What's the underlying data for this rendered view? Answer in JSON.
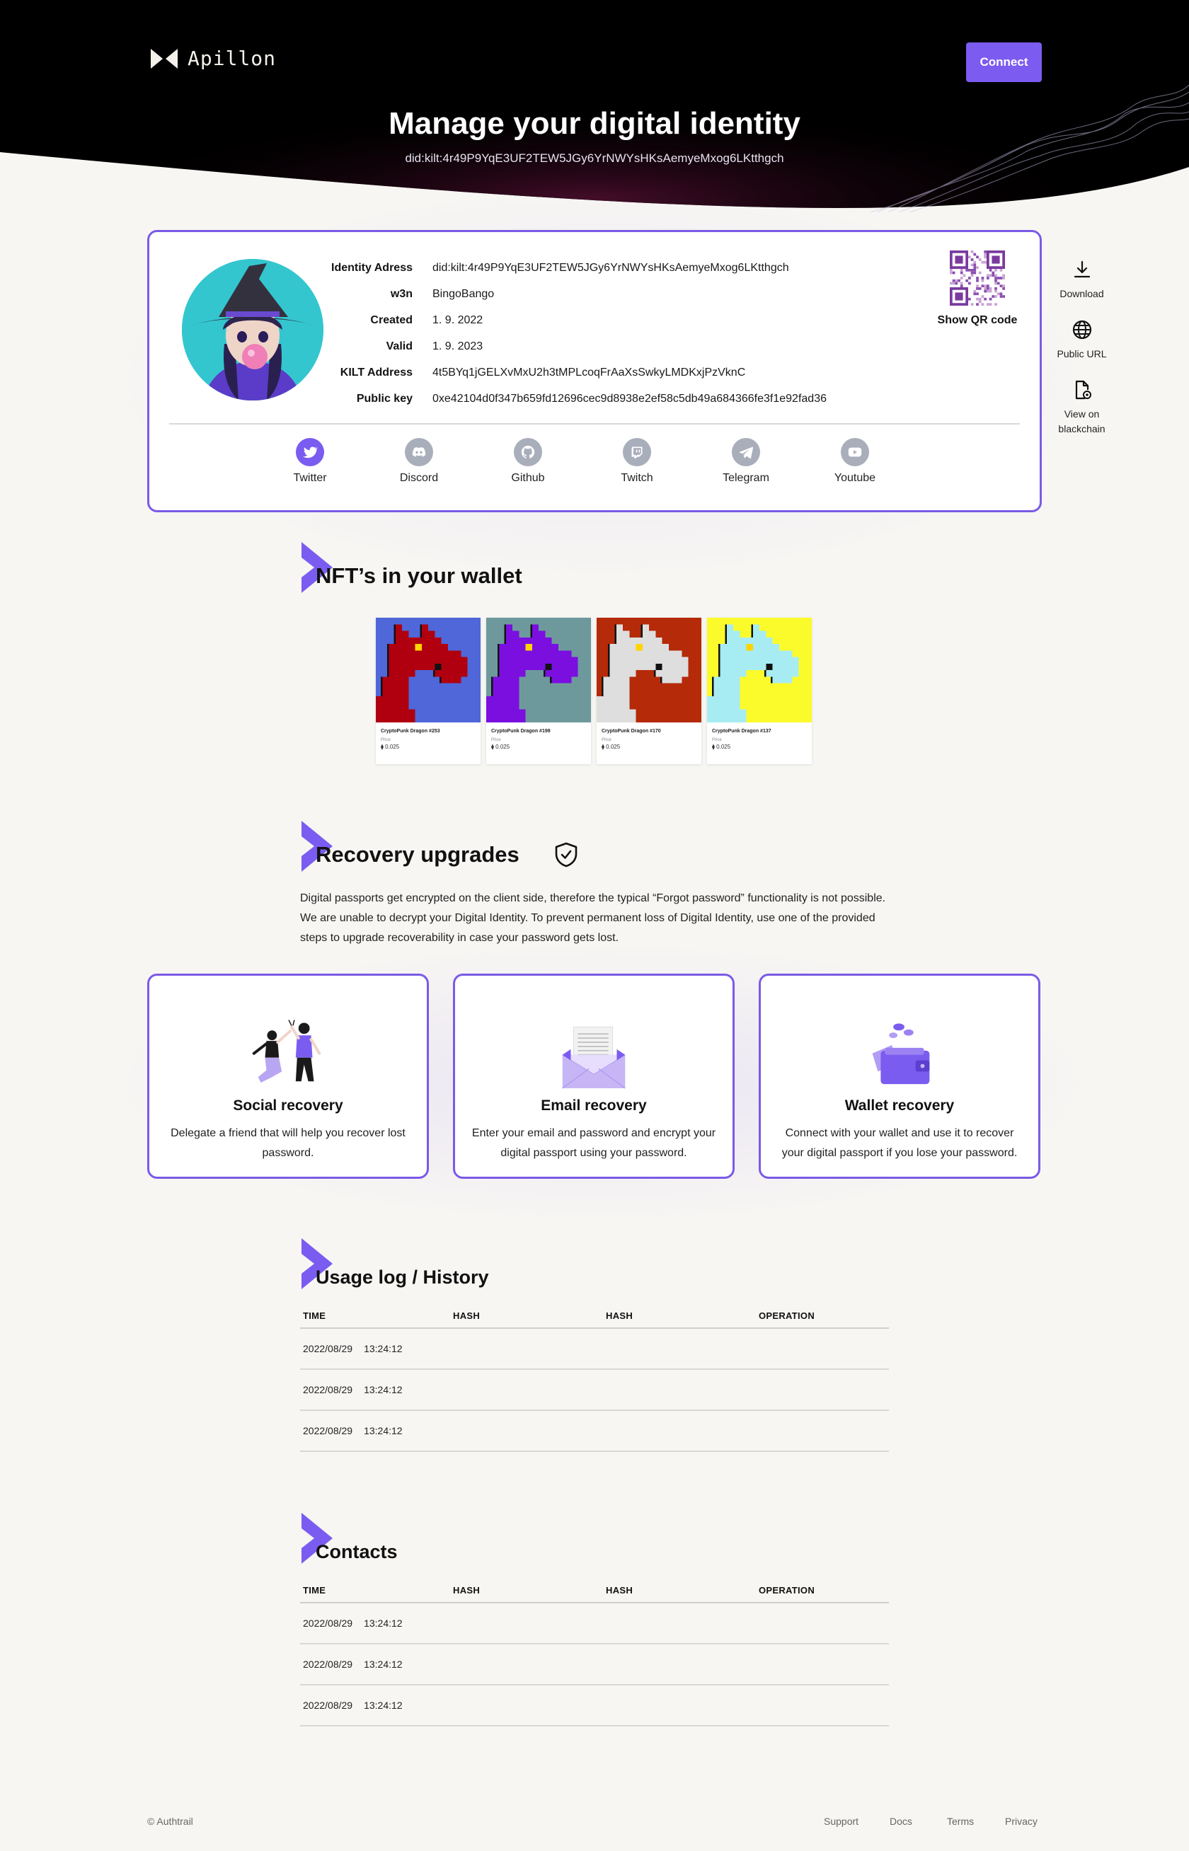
{
  "header": {
    "brand": "Apillon",
    "connect_label": "Connect",
    "title": "Manage your digital identity",
    "did": "did:kilt:4r49P9YqE3UF2TEW5JGy6YrNWYsHKsAemyeMxog6LKtthgch"
  },
  "identity": {
    "rows": [
      {
        "label": "Identity Adress",
        "value": "did:kilt:4r49P9YqE3UF2TEW5JGy6YrNWYsHKsAemyeMxog6LKtthgch"
      },
      {
        "label": "w3n",
        "value": "BingoBango"
      },
      {
        "label": "Created",
        "value": "1. 9. 2022"
      },
      {
        "label": "Valid",
        "value": "1. 9. 2023"
      },
      {
        "label": "KILT Address",
        "value": "4t5BYq1jGELXvMxU2h3tMPLcoqFrAaXsSwkyLMDKxjPzVknC"
      },
      {
        "label": "Public key",
        "value": "0xe42104d0f347b659fd12696cec9d8938e2ef58c5db49a684366fe3f1e92fad36"
      }
    ],
    "qr_label": "Show QR code",
    "socials": [
      {
        "label": "Twitter",
        "icon": "twitter-icon",
        "active": true
      },
      {
        "label": "Discord",
        "icon": "discord-icon",
        "active": false
      },
      {
        "label": "Github",
        "icon": "github-icon",
        "active": false
      },
      {
        "label": "Twitch",
        "icon": "twitch-icon",
        "active": false
      },
      {
        "label": "Telegram",
        "icon": "telegram-icon",
        "active": false
      },
      {
        "label": "Youtube",
        "icon": "youtube-icon",
        "active": false
      }
    ]
  },
  "side_actions": [
    {
      "label": "Download",
      "icon": "download-icon"
    },
    {
      "label": "Public URL",
      "icon": "globe-icon"
    },
    {
      "label": "View on blackchain",
      "icon": "document-view-icon"
    }
  ],
  "nfts": {
    "title": "NFT’s in your wallet",
    "items": [
      {
        "name": "CryptoPunk Dragon #253",
        "price_label": "Price",
        "price": "⧫ 0.025",
        "bg": "#4f67d9",
        "body": "#b00010"
      },
      {
        "name": "CryptoPunk Dragon #198",
        "price_label": "Price",
        "price": "⧫ 0.025",
        "bg": "#6e999c",
        "body": "#7a0fe0"
      },
      {
        "name": "CryptoPunk Dragon #170",
        "price_label": "Price",
        "price": "⧫ 0.025",
        "bg": "#b52a09",
        "body": "#dedede"
      },
      {
        "name": "CryptoPunk Dragon #137",
        "price_label": "Price",
        "price": "⧫ 0.025",
        "bg": "#fbfb2c",
        "body": "#a7ecf2"
      }
    ]
  },
  "recovery": {
    "title": "Recovery upgrades",
    "text": "Digital passports get encrypted on the client side, therefore the typical “Forgot password” functionality is not possible. We are unable to decrypt your Digital Identity. To prevent permanent loss of Digital Identity, use one of the provided steps to upgrade recoverability in case your password gets lost.",
    "cards": [
      {
        "title": "Social recovery",
        "desc": "Delegate a friend that will help you recover lost password."
      },
      {
        "title": "Email recovery",
        "desc": "Enter your email and password and encrypt your digital passport using your password."
      },
      {
        "title": "Wallet recovery",
        "desc": "Connect with your wallet and use it to recover your digital passport if you lose your password."
      }
    ]
  },
  "usage_log": {
    "title": "Usage log / History",
    "columns": [
      "TIME",
      "HASH",
      "HASH",
      "OPERATION"
    ],
    "rows": [
      {
        "date": "2022/08/29",
        "time": "13:24:12"
      },
      {
        "date": "2022/08/29",
        "time": "13:24:12"
      },
      {
        "date": "2022/08/29",
        "time": "13:24:12"
      }
    ]
  },
  "contacts": {
    "title": "Contacts",
    "columns": [
      "TIME",
      "HASH",
      "HASH",
      "OPERATION"
    ],
    "rows": [
      {
        "date": "2022/08/29",
        "time": "13:24:12"
      },
      {
        "date": "2022/08/29",
        "time": "13:24:12"
      },
      {
        "date": "2022/08/29",
        "time": "13:24:12"
      }
    ]
  },
  "footer": {
    "copyright": "© Authtrail",
    "links": [
      "Support",
      "Docs",
      "Terms",
      "Privacy"
    ]
  },
  "colors": {
    "accent": "#7c5bf0",
    "border": "#7b5ae6",
    "hero_bg": "#000000",
    "page_bg": "#f7f6f3",
    "social_active": "#7b5cf0",
    "social_inactive": "#a9aebb"
  }
}
